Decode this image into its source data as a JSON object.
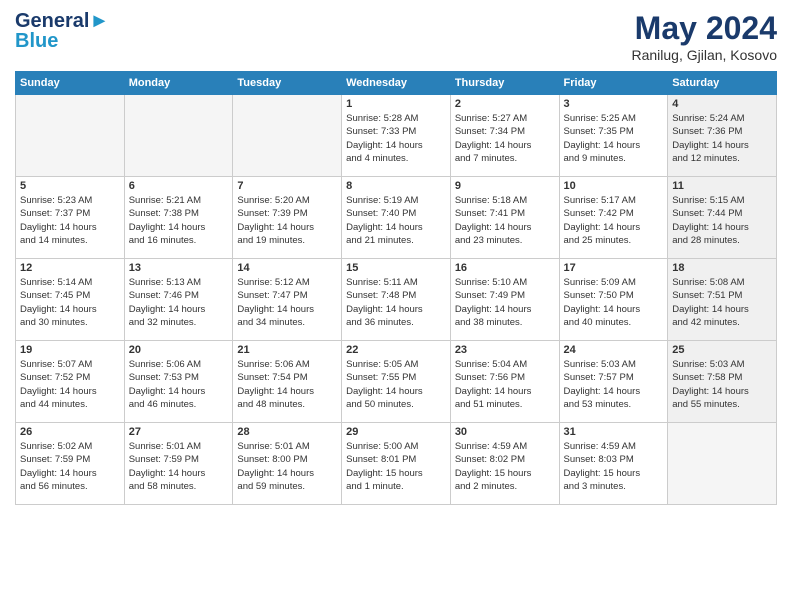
{
  "header": {
    "logo_line1": "General",
    "logo_line2": "Blue",
    "month": "May 2024",
    "location": "Ranilug, Gjilan, Kosovo"
  },
  "weekdays": [
    "Sunday",
    "Monday",
    "Tuesday",
    "Wednesday",
    "Thursday",
    "Friday",
    "Saturday"
  ],
  "weeks": [
    [
      {
        "day": "",
        "info": "",
        "empty": true
      },
      {
        "day": "",
        "info": "",
        "empty": true
      },
      {
        "day": "",
        "info": "",
        "empty": true
      },
      {
        "day": "1",
        "info": "Sunrise: 5:28 AM\nSunset: 7:33 PM\nDaylight: 14 hours\nand 4 minutes."
      },
      {
        "day": "2",
        "info": "Sunrise: 5:27 AM\nSunset: 7:34 PM\nDaylight: 14 hours\nand 7 minutes."
      },
      {
        "day": "3",
        "info": "Sunrise: 5:25 AM\nSunset: 7:35 PM\nDaylight: 14 hours\nand 9 minutes."
      },
      {
        "day": "4",
        "info": "Sunrise: 5:24 AM\nSunset: 7:36 PM\nDaylight: 14 hours\nand 12 minutes.",
        "shaded": true
      }
    ],
    [
      {
        "day": "5",
        "info": "Sunrise: 5:23 AM\nSunset: 7:37 PM\nDaylight: 14 hours\nand 14 minutes."
      },
      {
        "day": "6",
        "info": "Sunrise: 5:21 AM\nSunset: 7:38 PM\nDaylight: 14 hours\nand 16 minutes."
      },
      {
        "day": "7",
        "info": "Sunrise: 5:20 AM\nSunset: 7:39 PM\nDaylight: 14 hours\nand 19 minutes."
      },
      {
        "day": "8",
        "info": "Sunrise: 5:19 AM\nSunset: 7:40 PM\nDaylight: 14 hours\nand 21 minutes."
      },
      {
        "day": "9",
        "info": "Sunrise: 5:18 AM\nSunset: 7:41 PM\nDaylight: 14 hours\nand 23 minutes."
      },
      {
        "day": "10",
        "info": "Sunrise: 5:17 AM\nSunset: 7:42 PM\nDaylight: 14 hours\nand 25 minutes."
      },
      {
        "day": "11",
        "info": "Sunrise: 5:15 AM\nSunset: 7:44 PM\nDaylight: 14 hours\nand 28 minutes.",
        "shaded": true
      }
    ],
    [
      {
        "day": "12",
        "info": "Sunrise: 5:14 AM\nSunset: 7:45 PM\nDaylight: 14 hours\nand 30 minutes."
      },
      {
        "day": "13",
        "info": "Sunrise: 5:13 AM\nSunset: 7:46 PM\nDaylight: 14 hours\nand 32 minutes."
      },
      {
        "day": "14",
        "info": "Sunrise: 5:12 AM\nSunset: 7:47 PM\nDaylight: 14 hours\nand 34 minutes."
      },
      {
        "day": "15",
        "info": "Sunrise: 5:11 AM\nSunset: 7:48 PM\nDaylight: 14 hours\nand 36 minutes."
      },
      {
        "day": "16",
        "info": "Sunrise: 5:10 AM\nSunset: 7:49 PM\nDaylight: 14 hours\nand 38 minutes."
      },
      {
        "day": "17",
        "info": "Sunrise: 5:09 AM\nSunset: 7:50 PM\nDaylight: 14 hours\nand 40 minutes."
      },
      {
        "day": "18",
        "info": "Sunrise: 5:08 AM\nSunset: 7:51 PM\nDaylight: 14 hours\nand 42 minutes.",
        "shaded": true
      }
    ],
    [
      {
        "day": "19",
        "info": "Sunrise: 5:07 AM\nSunset: 7:52 PM\nDaylight: 14 hours\nand 44 minutes."
      },
      {
        "day": "20",
        "info": "Sunrise: 5:06 AM\nSunset: 7:53 PM\nDaylight: 14 hours\nand 46 minutes."
      },
      {
        "day": "21",
        "info": "Sunrise: 5:06 AM\nSunset: 7:54 PM\nDaylight: 14 hours\nand 48 minutes."
      },
      {
        "day": "22",
        "info": "Sunrise: 5:05 AM\nSunset: 7:55 PM\nDaylight: 14 hours\nand 50 minutes."
      },
      {
        "day": "23",
        "info": "Sunrise: 5:04 AM\nSunset: 7:56 PM\nDaylight: 14 hours\nand 51 minutes."
      },
      {
        "day": "24",
        "info": "Sunrise: 5:03 AM\nSunset: 7:57 PM\nDaylight: 14 hours\nand 53 minutes."
      },
      {
        "day": "25",
        "info": "Sunrise: 5:03 AM\nSunset: 7:58 PM\nDaylight: 14 hours\nand 55 minutes.",
        "shaded": true
      }
    ],
    [
      {
        "day": "26",
        "info": "Sunrise: 5:02 AM\nSunset: 7:59 PM\nDaylight: 14 hours\nand 56 minutes."
      },
      {
        "day": "27",
        "info": "Sunrise: 5:01 AM\nSunset: 7:59 PM\nDaylight: 14 hours\nand 58 minutes."
      },
      {
        "day": "28",
        "info": "Sunrise: 5:01 AM\nSunset: 8:00 PM\nDaylight: 14 hours\nand 59 minutes."
      },
      {
        "day": "29",
        "info": "Sunrise: 5:00 AM\nSunset: 8:01 PM\nDaylight: 15 hours\nand 1 minute."
      },
      {
        "day": "30",
        "info": "Sunrise: 4:59 AM\nSunset: 8:02 PM\nDaylight: 15 hours\nand 2 minutes."
      },
      {
        "day": "31",
        "info": "Sunrise: 4:59 AM\nSunset: 8:03 PM\nDaylight: 15 hours\nand 3 minutes."
      },
      {
        "day": "",
        "info": "",
        "empty": true,
        "shaded": true
      }
    ]
  ]
}
